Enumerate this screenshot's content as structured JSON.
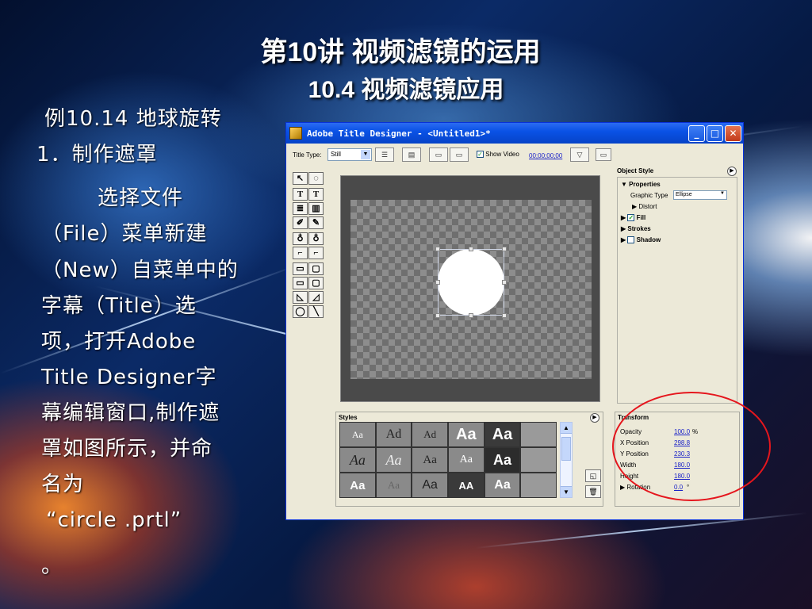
{
  "slide": {
    "title_line1": "第10讲 视频滤镜的运用",
    "title_line2": "10.4 视频滤镜应用",
    "body_lines": [
      "例10.14 地球旋转",
      "1．制作遮罩",
      "    选择文件",
      "（File）菜单新建",
      "（New）自菜单中的",
      "字幕（Title）选",
      "项，打开Adobe",
      "Title Designer字",
      "幕编辑窗口,制作遮",
      "罩如图所示，并命",
      "名为",
      "“circle .prtl”",
      "。"
    ]
  },
  "window": {
    "title": "Adobe Title Designer - <Untitled1>*",
    "controls": {
      "minimize": "_",
      "maximize": "□",
      "close": "✕"
    },
    "toolbar": {
      "title_type_label": "Title Type:",
      "title_type_value": "Still",
      "show_video_label": "Show Video",
      "show_video_checked": true,
      "timecode": "00;00;00;00"
    },
    "tools": [
      "↖",
      "◌",
      "T",
      "T",
      "≣",
      "▥",
      "✐",
      "✎",
      "♁",
      "♁",
      "⌐",
      "⌐",
      "▭",
      "▢",
      "▭",
      "▢",
      "◺",
      "◿",
      "◯",
      "╲"
    ],
    "object_style": {
      "header": "Object Style",
      "properties_label": "Properties",
      "graphic_type_label": "Graphic Type",
      "graphic_type_value": "Ellipse",
      "distort_label": "Distort",
      "fill_label": "Fill",
      "fill_checked": true,
      "strokes_label": "Strokes",
      "shadow_label": "Shadow",
      "shadow_checked": false
    },
    "styles": {
      "header": "Styles",
      "swatches": [
        "Aa",
        "Ad",
        "Ad",
        "Aa",
        "Aa",
        "",
        "Aa",
        "Aa",
        "Aa",
        "Aa",
        "Aa",
        "",
        "Aa",
        "Aa",
        "Aa",
        "AA",
        "Aa",
        ""
      ]
    },
    "transform": {
      "header": "Transform",
      "rows": [
        {
          "label": "Opacity",
          "value": "100.0",
          "unit": "%"
        },
        {
          "label": "X Position",
          "value": "298.8",
          "unit": ""
        },
        {
          "label": "Y Position",
          "value": "230.3",
          "unit": ""
        },
        {
          "label": "Width",
          "value": "180.0",
          "unit": ""
        },
        {
          "label": "Height",
          "value": "180.0",
          "unit": ""
        },
        {
          "label": "Rotation",
          "value": "0.0",
          "unit": "°"
        }
      ]
    }
  },
  "colors": {
    "titlebar": "#0a52e6",
    "annotation_ellipse": "#e5161d",
    "link_value": "#1a22c8"
  }
}
